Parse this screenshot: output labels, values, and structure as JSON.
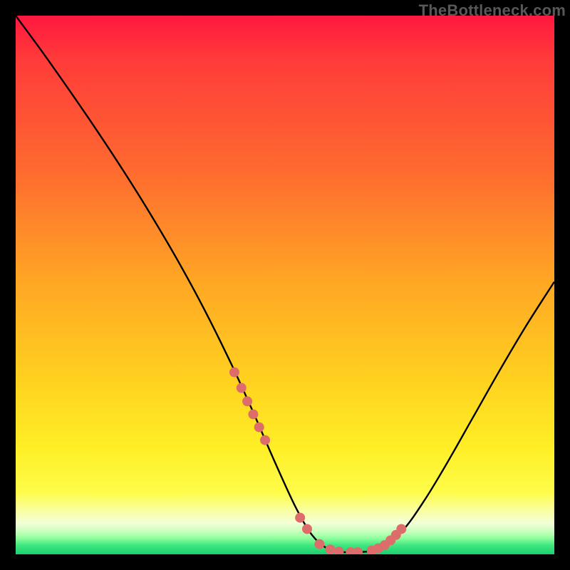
{
  "watermark": "TheBottleneck.com",
  "chart_data": {
    "type": "line",
    "title": "",
    "xlabel": "",
    "ylabel": "",
    "xlim": [
      0,
      100
    ],
    "ylim": [
      0,
      100
    ],
    "grid": false,
    "legend": false,
    "series": [
      {
        "name": "bottleneck-curve",
        "x": [
          0,
          5,
          10,
          15,
          20,
          25,
          30,
          35,
          40,
          44,
          48,
          52,
          55,
          58,
          61,
          64,
          68,
          72,
          76,
          80,
          85,
          90,
          95,
          100
        ],
        "y": [
          100,
          93.2,
          86.1,
          78.8,
          71.2,
          63.2,
          54.7,
          45.5,
          35.4,
          26.6,
          17.4,
          8.7,
          3.6,
          1.0,
          0.4,
          0.4,
          1.2,
          4.6,
          10.2,
          16.8,
          25.6,
          34.4,
          42.8,
          50.6
        ]
      }
    ],
    "markers": {
      "name": "sample-points",
      "x": [
        40.6,
        41.9,
        43.0,
        44.1,
        45.2,
        46.3,
        52.8,
        54.1,
        56.4,
        58.4,
        60.0,
        62.2,
        63.5,
        66.1,
        67.3,
        68.5,
        69.6,
        70.6,
        71.6
      ],
      "y": [
        33.8,
        30.9,
        28.4,
        26.0,
        23.6,
        21.2,
        6.8,
        4.7,
        1.9,
        0.9,
        0.5,
        0.4,
        0.4,
        0.7,
        1.1,
        1.7,
        2.6,
        3.6,
        4.7
      ]
    },
    "annotations": []
  }
}
